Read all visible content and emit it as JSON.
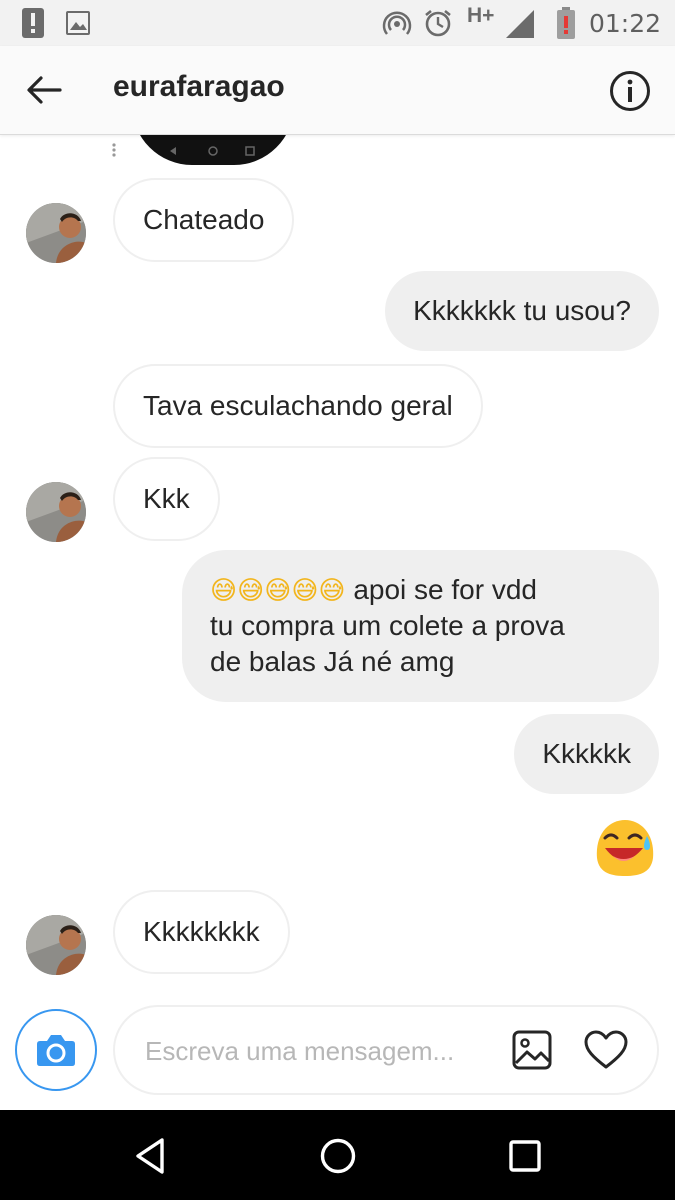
{
  "status_bar": {
    "time": "01:22",
    "network": "H+",
    "icons": [
      "alert-icon",
      "image-icon",
      "hotspot-icon",
      "alarm-icon",
      "network-type-icon",
      "signal-icon",
      "battery-low-icon"
    ]
  },
  "header": {
    "username": "eurafaragao",
    "back_icon": "arrow-left-icon",
    "info_icon": "info-icon"
  },
  "messages": [
    {
      "id": "m1",
      "direction": "incoming",
      "text": "Chateado",
      "avatar": true
    },
    {
      "id": "m2",
      "direction": "outgoing",
      "text": "Kkkkkkk tu usou?"
    },
    {
      "id": "m3",
      "direction": "incoming",
      "text": "Tava esculachando geral",
      "avatar": false
    },
    {
      "id": "m4",
      "direction": "incoming",
      "text": "Kkk",
      "avatar": true
    },
    {
      "id": "m5",
      "direction": "outgoing",
      "emoji_prefix": "😅😅😅😅😅",
      "line1": "apoi se for vdd",
      "line2": "tu compra um colete a prova",
      "line3": "de balas Já né amg"
    },
    {
      "id": "m6",
      "direction": "outgoing",
      "text": "Kkkkkk"
    },
    {
      "id": "m7",
      "direction": "outgoing",
      "emoji": "😅"
    },
    {
      "id": "m8",
      "direction": "incoming",
      "text": "Kkkkkkkk",
      "avatar": true
    }
  ],
  "composer": {
    "placeholder": "Escreva uma mensagem...",
    "value": "",
    "camera_icon": "camera-icon",
    "gallery_icon": "gallery-icon",
    "like_icon": "heart-icon"
  },
  "colors": {
    "accent": "#3897f0",
    "outgoing_bubble": "#efefef",
    "incoming_border": "#efefef",
    "text": "#262626"
  },
  "nav_bar": {
    "buttons": [
      "back-triangle-icon",
      "home-circle-icon",
      "recents-square-icon"
    ]
  }
}
